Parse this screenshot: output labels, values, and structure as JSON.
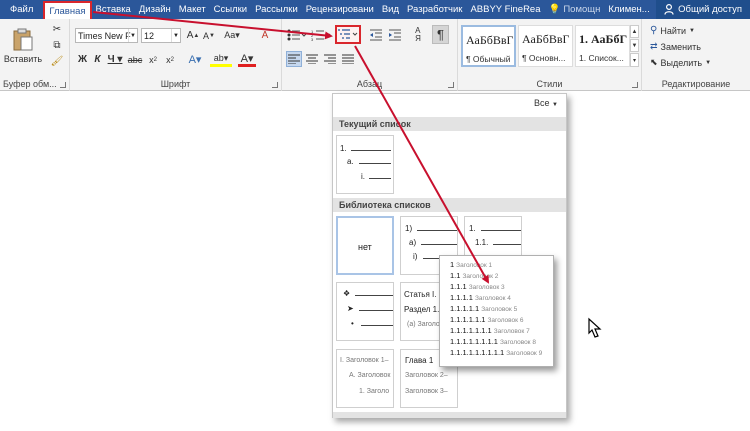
{
  "tabs": [
    {
      "label": "Файл",
      "type": "file"
    },
    {
      "label": "Главная",
      "type": "active"
    },
    {
      "label": "Вставка",
      "type": "normal"
    },
    {
      "label": "Дизайн",
      "type": "normal"
    },
    {
      "label": "Макет",
      "type": "normal"
    },
    {
      "label": "Ссылки",
      "type": "normal"
    },
    {
      "label": "Рассылки",
      "type": "normal"
    },
    {
      "label": "Рецензировани",
      "type": "normal"
    },
    {
      "label": "Вид",
      "type": "normal"
    },
    {
      "label": "Разработчик",
      "type": "normal"
    },
    {
      "label": "ABBYY FineRea",
      "type": "normal"
    },
    {
      "label": "Помощн",
      "type": "normal"
    },
    {
      "label": "Климен...",
      "type": "normal"
    }
  ],
  "share_label": "Общий доступ",
  "clipboard": {
    "paste_label": "Вставить",
    "group_label": "Буфер обм..."
  },
  "font": {
    "name": "Times New F",
    "size": "12",
    "group_label": "Шрифт"
  },
  "paragraph": {
    "group_label": "Абзац"
  },
  "styles": {
    "group_label": "Стили",
    "items": [
      {
        "preview": "АаБбВвГ",
        "name": "¶ Обычный"
      },
      {
        "preview": "АаБбВвГ",
        "name": "¶ Основн..."
      },
      {
        "preview": "1. АаБбГ",
        "name": "1. Список..."
      }
    ]
  },
  "editing": {
    "find_label": "Найти",
    "replace_label": "Заменить",
    "select_label": "Выделить",
    "group_label": "Редактирование"
  },
  "gallery": {
    "filter_label": "Все",
    "current_title": "Текущий список",
    "library_title": "Библиотека списков",
    "none_label": "нет",
    "current_card": [
      "1.",
      "a.",
      "i."
    ],
    "card_paren": [
      "1)",
      "a)",
      "i)"
    ],
    "card_decimal": [
      "1.",
      "1.1."
    ],
    "card_bullets": [
      "❖",
      "➤",
      "•"
    ],
    "card_article": [
      "Статья I.",
      "Раздел 1.",
      "(a) Заголо"
    ],
    "card_roman": [
      "I. Заголовок 1–",
      "A. Заголовок",
      "1. Заголо"
    ],
    "card_chapter": [
      "Глава 1",
      "Заголовок 2–",
      "Заголовок 3–"
    ]
  },
  "popup": {
    "rows": [
      {
        "num": "1",
        "text": "Заголовок 1"
      },
      {
        "num": "1.1",
        "text": "Заголовок 2"
      },
      {
        "num": "1.1.1",
        "text": "Заголовок 3"
      },
      {
        "num": "1.1.1.1",
        "text": "Заголовок 4"
      },
      {
        "num": "1.1.1.1.1",
        "text": "Заголовок 5"
      },
      {
        "num": "1.1.1.1.1.1",
        "text": "Заголовок 6"
      },
      {
        "num": "1.1.1.1.1.1.1",
        "text": "Заголовок 7"
      },
      {
        "num": "1.1.1.1.1.1.1.1",
        "text": "Заголовок 8"
      },
      {
        "num": "1.1.1.1.1.1.1.1.1",
        "text": "Заголовок 9"
      }
    ]
  },
  "colors": {
    "ribbon_blue": "#2b579a",
    "highlight_red": "#d9262c",
    "arrow_red": "#c8102e"
  }
}
